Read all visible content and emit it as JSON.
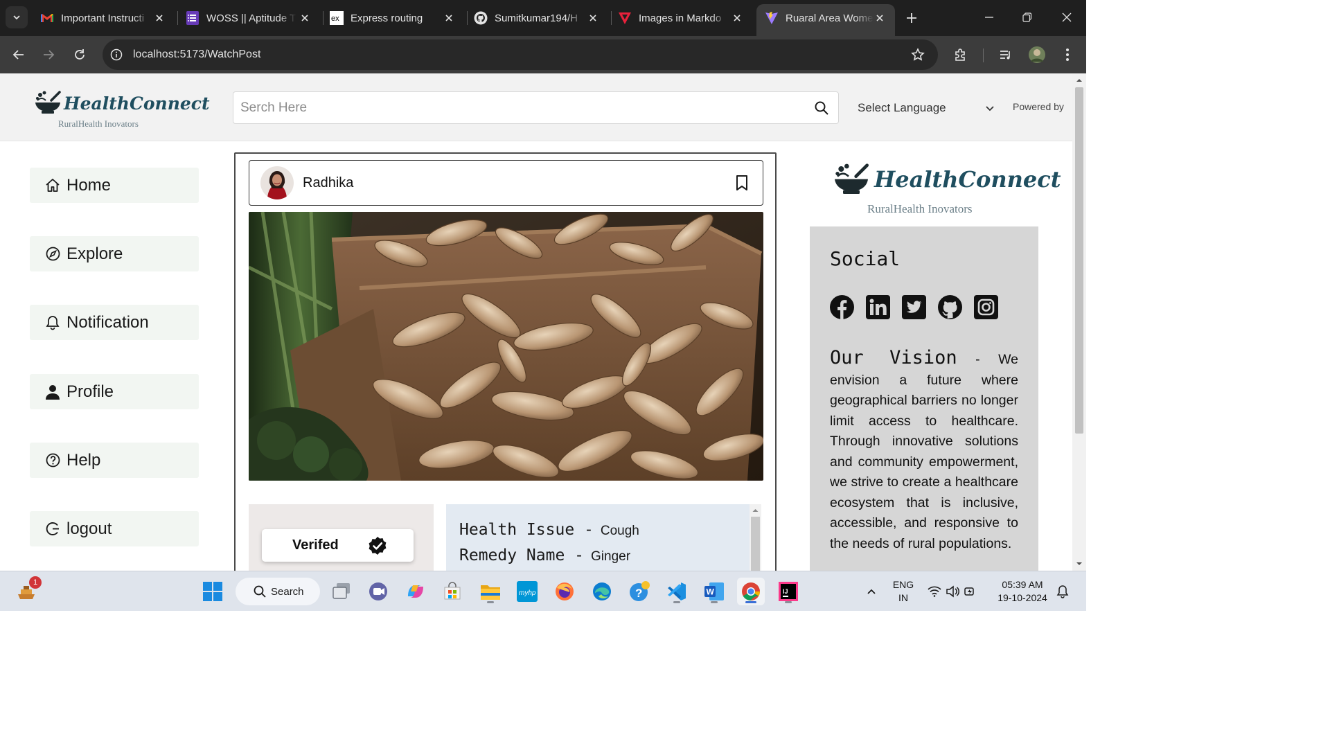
{
  "browser": {
    "tabs": [
      {
        "title": "Important Instructi",
        "icon": "gmail-icon",
        "active": false
      },
      {
        "title": "WOSS || Aptitude T",
        "icon": "forms-icon",
        "active": false
      },
      {
        "title": "Express routing",
        "icon": "express-icon",
        "active": false
      },
      {
        "title": "Sumitkumar194/H",
        "icon": "github-icon",
        "active": false
      },
      {
        "title": "Images in Markdo",
        "icon": "markdown-icon",
        "active": false
      },
      {
        "title": "Ruaral Area Wome",
        "icon": "vite-icon",
        "active": true
      }
    ],
    "url": "localhost:5173/WatchPost"
  },
  "site": {
    "brand": "HealthConnect",
    "tagline": "RuralHealth Inovators",
    "search_placeholder": "Serch Here",
    "language_label": "Select Language",
    "powered_by": "Powered by"
  },
  "nav": [
    {
      "label": "Home",
      "icon": "home-icon"
    },
    {
      "label": "Explore",
      "icon": "compass-icon"
    },
    {
      "label": "Notification",
      "icon": "bell-icon"
    },
    {
      "label": "Profile",
      "icon": "user-icon"
    },
    {
      "label": "Help",
      "icon": "help-icon"
    },
    {
      "label": "logout",
      "icon": "logout-icon"
    }
  ],
  "post": {
    "author": "Radhika",
    "image_alt": "ginger roots in a cardboard box",
    "verified_label": "Verifed",
    "info": {
      "health_issue_key": "Health Issue -",
      "health_issue_value": "Cough",
      "remedy_key": "Remedy Name -",
      "remedy_value": "Ginger"
    }
  },
  "sidebar_right": {
    "brand": "HealthConnect",
    "tagline": "RuralHealth Inovators",
    "social_title": "Social",
    "social_icons": [
      "facebook-icon",
      "linkedin-icon",
      "twitter-icon",
      "github-icon",
      "instagram-icon"
    ],
    "vision_heading": "Our Vision",
    "vision_text": " - We envision a future where geographical barriers no longer limit access to healthcare. Through innovative solutions and community empowerment, we strive to create a healthcare ecosystem that is inclusive, accessible, and responsive to the needs of rural populations."
  },
  "taskbar": {
    "search_label": "Search",
    "notification_badge": "1",
    "lang_line1": "ENG",
    "lang_line2": "IN",
    "time": "05:39 AM",
    "date": "19-10-2024"
  }
}
